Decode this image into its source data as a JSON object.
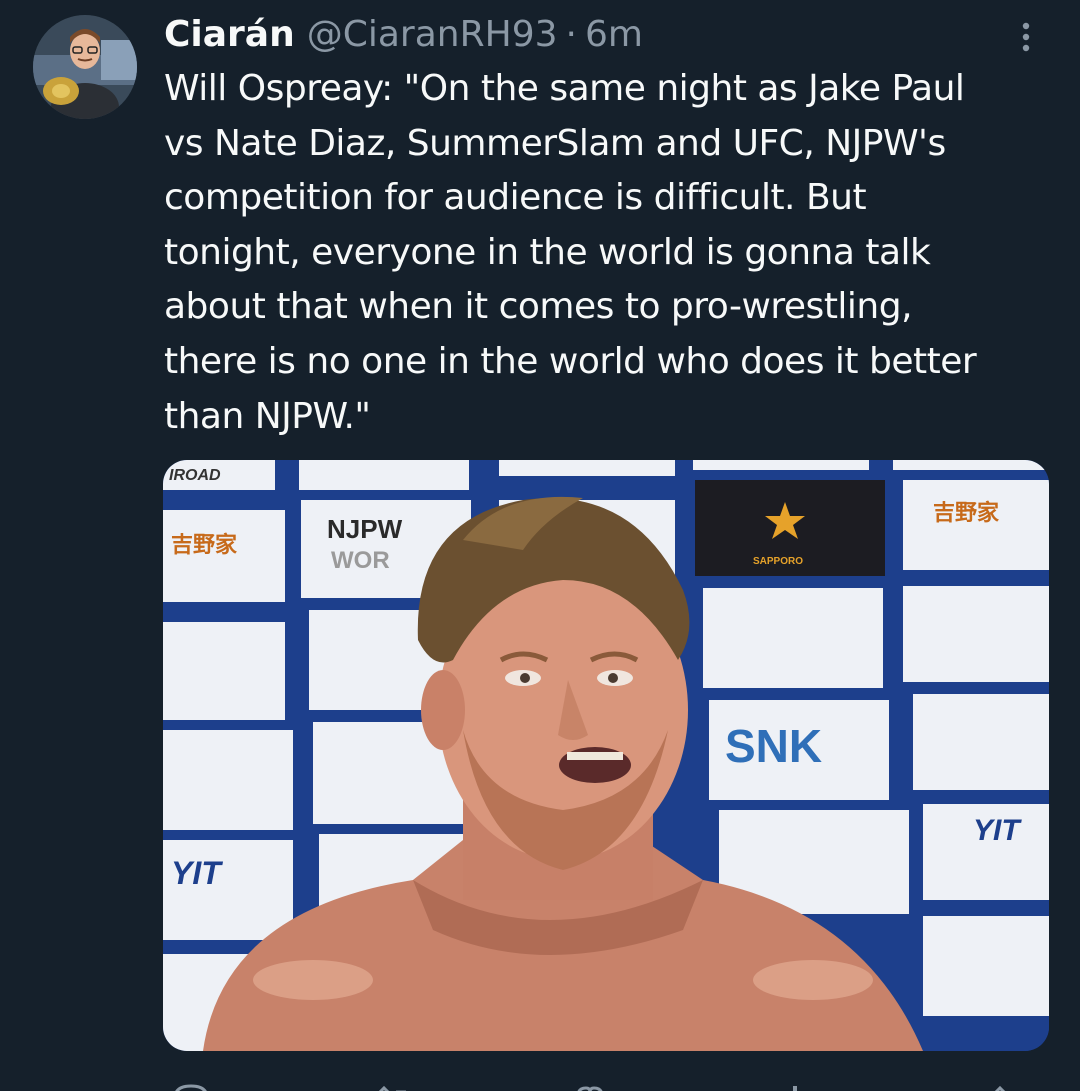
{
  "tweet": {
    "author": {
      "display_name": "Ciarán",
      "handle": "@CiaranRH93"
    },
    "separator": "·",
    "time": "6m",
    "text": "Will Ospreay: \"On the same night as Jake Paul\nvs Nate Diaz, SummerSlam and UFC, NJPW's\ncompetition for audience is difficult. But\ntonight, everyone in the world is gonna talk\nabout that when it comes to pro-wrestling,\nthere is no one in the world who does it better\nthan NJPW.\""
  },
  "media": {
    "backdrop_logos": [
      "NJPW",
      "WORLD",
      "SNK",
      "SAPPORO",
      "YOSHINOYA",
      "YTT"
    ]
  },
  "icons": {
    "more": "vertical-ellipsis-icon",
    "reply": "reply-icon",
    "retweet": "retweet-icon",
    "like": "heart-icon",
    "views": "views-icon",
    "share": "share-icon"
  },
  "colors": {
    "background": "#15202b",
    "text": "#f7f9f9",
    "secondary_text": "#8b98a5",
    "backdrop_blue": "#1d3f8c"
  }
}
